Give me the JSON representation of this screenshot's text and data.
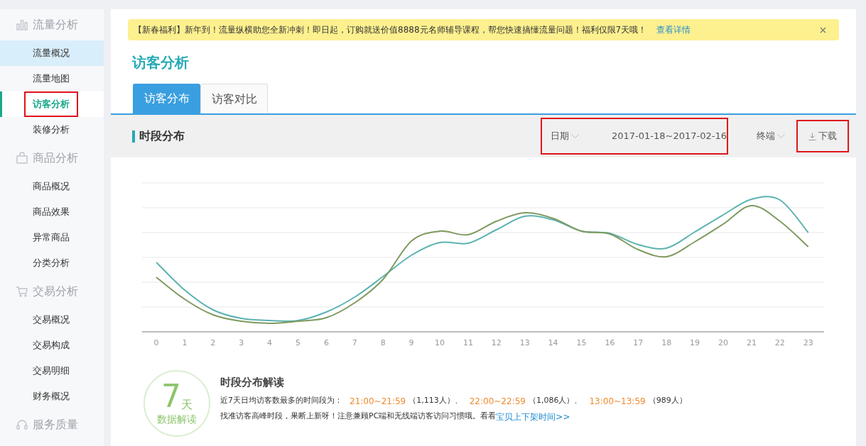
{
  "sidebar": {
    "groups": [
      {
        "label": "流量分析",
        "items": [
          {
            "label": "流量概况",
            "selected": false,
            "hovered": true,
            "annotated": false
          },
          {
            "label": "流量地图",
            "selected": false,
            "hovered": false,
            "annotated": false
          },
          {
            "label": "访客分析",
            "selected": true,
            "hovered": false,
            "annotated": true
          },
          {
            "label": "装修分析",
            "selected": false,
            "hovered": false,
            "annotated": false
          }
        ]
      },
      {
        "label": "商品分析",
        "items": [
          {
            "label": "商品概况",
            "selected": false,
            "hovered": false,
            "annotated": false
          },
          {
            "label": "商品效果",
            "selected": false,
            "hovered": false,
            "annotated": false
          },
          {
            "label": "异常商品",
            "selected": false,
            "hovered": false,
            "annotated": false
          },
          {
            "label": "分类分析",
            "selected": false,
            "hovered": false,
            "annotated": false
          }
        ]
      },
      {
        "label": "交易分析",
        "items": [
          {
            "label": "交易概况",
            "selected": false,
            "hovered": false,
            "annotated": false
          },
          {
            "label": "交易构成",
            "selected": false,
            "hovered": false,
            "annotated": false
          },
          {
            "label": "交易明细",
            "selected": false,
            "hovered": false,
            "annotated": false
          },
          {
            "label": "财务概况",
            "selected": false,
            "hovered": false,
            "annotated": false
          }
        ]
      },
      {
        "label": "服务质量"
      }
    ]
  },
  "banner": {
    "text": "【新春福利】新年到！流量纵横助您全新冲刺！即日起，订购就送价值8888元名师辅导课程，帮您快速搞懂流量问题！福利仅限7天哦！",
    "link": "查看详情"
  },
  "page_title": "访客分析",
  "tabs": [
    {
      "label": "访客分布",
      "selected": true
    },
    {
      "label": "访客对比",
      "selected": false
    }
  ],
  "section": {
    "title": "时段分布",
    "date_filter": {
      "label": "日期",
      "range": "2017-01-18~2017-02-16",
      "annotated": true
    },
    "terminal_filter": {
      "label": "终端"
    },
    "download": {
      "label": "下载",
      "annotated": true
    }
  },
  "chart": {
    "x_labels": [
      "0",
      "1",
      "2",
      "3",
      "4",
      "5",
      "6",
      "7",
      "8",
      "9",
      "10",
      "11",
      "12",
      "13",
      "14",
      "15",
      "16",
      "17",
      "18",
      "19",
      "20",
      "21",
      "22",
      "23"
    ]
  },
  "summary": {
    "badge_number": "7",
    "badge_unit": "天",
    "badge_caption": "数据解读",
    "title": "时段分布解读",
    "line1_prefix": "近7天日均访客数最多的时间段为：",
    "separator": "、",
    "periods": [
      {
        "time": "21:00~21:59",
        "count": "（1,113人）"
      },
      {
        "time": "22:00~22:59",
        "count": "（1,086人）"
      },
      {
        "time": "13:00~13:59",
        "count": "（989人）"
      }
    ],
    "line2": "找准访客高峰时段，果断上新呀！注意兼顾PC端和无线端访客访问习惯哦。看看",
    "line2_link": "宝贝上下架时间>>"
  }
}
